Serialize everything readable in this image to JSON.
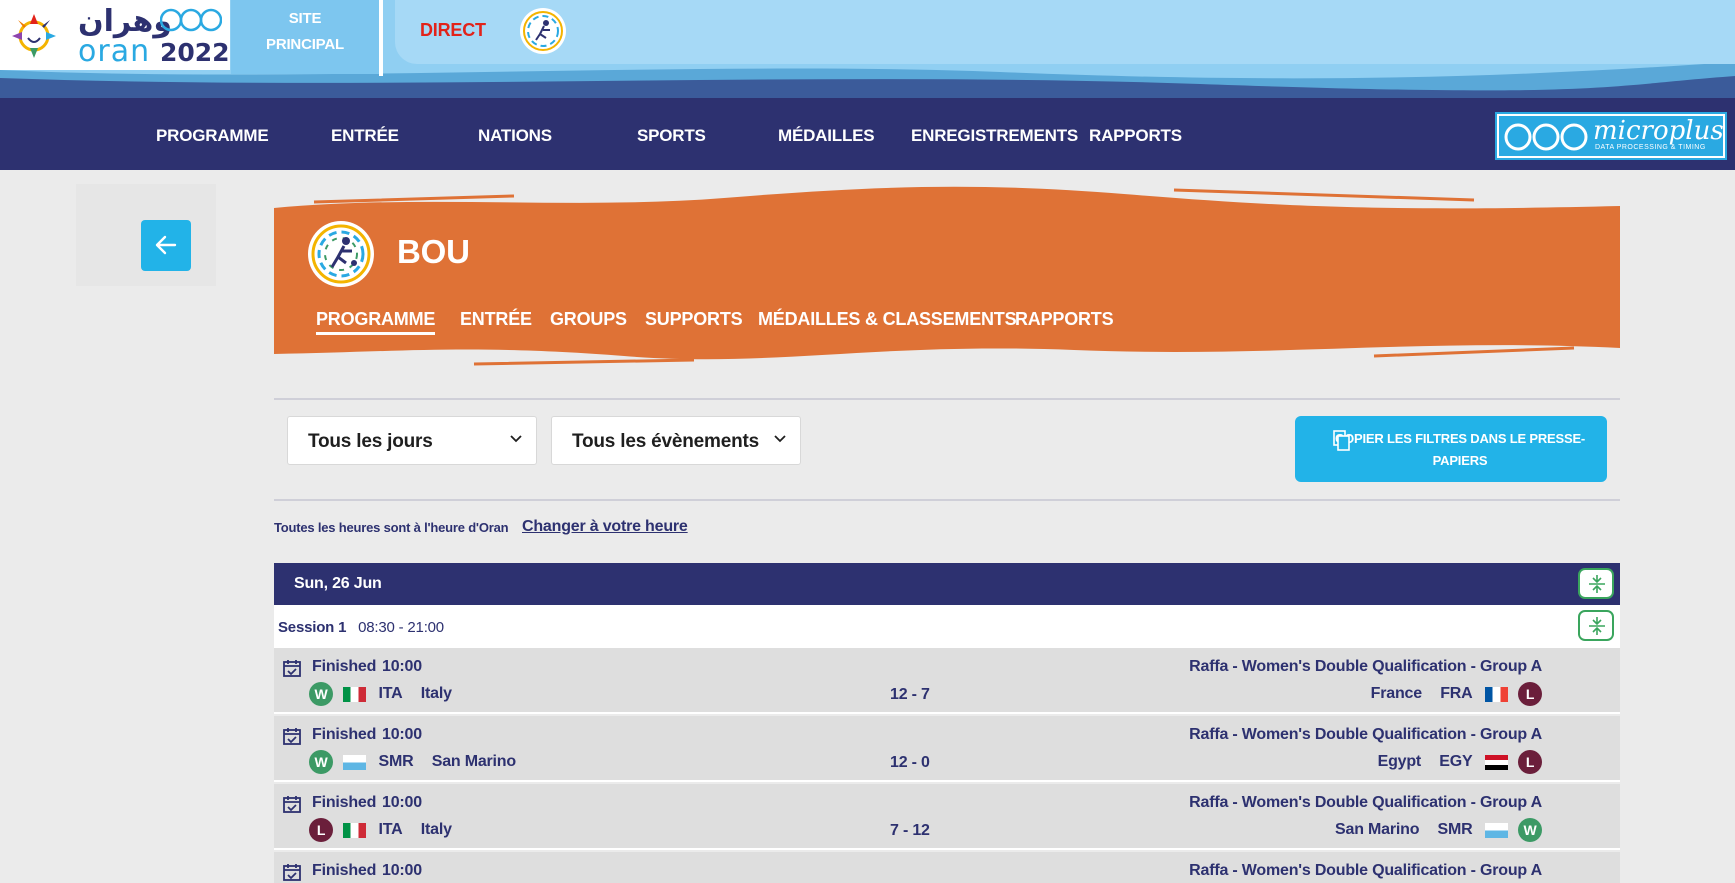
{
  "brand": {
    "arabic": "وهران",
    "city": "oran",
    "year": "2022"
  },
  "top": {
    "site_principal_line1": "SITE",
    "site_principal_line2": "PRINCIPAL",
    "direct": "DIRECT"
  },
  "mainnav": {
    "items": [
      "PROGRAMME",
      "ENTRÉE",
      "NATIONS",
      "SPORTS",
      "MÉDAILLES",
      "ENREGISTREMENTS",
      "RAPPORTS"
    ]
  },
  "sponsor": {
    "name": "microplus",
    "tagline": "DATA PROCESSING & TIMING"
  },
  "sport": {
    "title": "BOU",
    "tabs": [
      "PROGRAMME",
      "ENTRÉE",
      "GROUPS",
      "SUPPORTS",
      "MÉDAILLES & CLASSEMENTS",
      "RAPPORTS"
    ],
    "active_tab": "PROGRAMME"
  },
  "filters": {
    "days": "Tous les jours",
    "events": "Tous les évènements",
    "copy_label": "COPIER LES FILTRES DANS LE PRESSE-PAPIERS"
  },
  "timezone": {
    "note": "Toutes les heures sont à l'heure d'Oran",
    "link": "Changer à votre heure"
  },
  "schedule": {
    "date": "Sun, 26 Jun",
    "session_label": "Session 1",
    "session_time": "08:30 - 21:00",
    "matches": [
      {
        "status": "Finished",
        "time": "10:00",
        "event": "Raffa - Women's Double Qualification - Group A",
        "left": {
          "result": "W",
          "code": "ITA",
          "name": "Italy"
        },
        "score": "12 - 7",
        "right": {
          "result": "L",
          "code": "FRA",
          "name": "France"
        }
      },
      {
        "status": "Finished",
        "time": "10:00",
        "event": "Raffa - Women's Double Qualification - Group A",
        "left": {
          "result": "W",
          "code": "SMR",
          "name": "San Marino"
        },
        "score": "12 - 0",
        "right": {
          "result": "L",
          "code": "EGY",
          "name": "Egypt"
        }
      },
      {
        "status": "Finished",
        "time": "10:00",
        "event": "Raffa - Women's Double Qualification - Group A",
        "left": {
          "result": "L",
          "code": "ITA",
          "name": "Italy"
        },
        "score": "7 - 12",
        "right": {
          "result": "W",
          "code": "SMR",
          "name": "San Marino"
        }
      },
      {
        "status": "Finished",
        "time": "10:00",
        "event": "Raffa - Women's Double Qualification - Group A"
      }
    ]
  },
  "colors": {
    "navy": "#2d3170",
    "sky": "#90cff2",
    "orange": "#df7236",
    "cyan": "#22b3e8",
    "win": "#3c9a65",
    "loss": "#6b1f3b",
    "direct_red": "#e2231a"
  }
}
